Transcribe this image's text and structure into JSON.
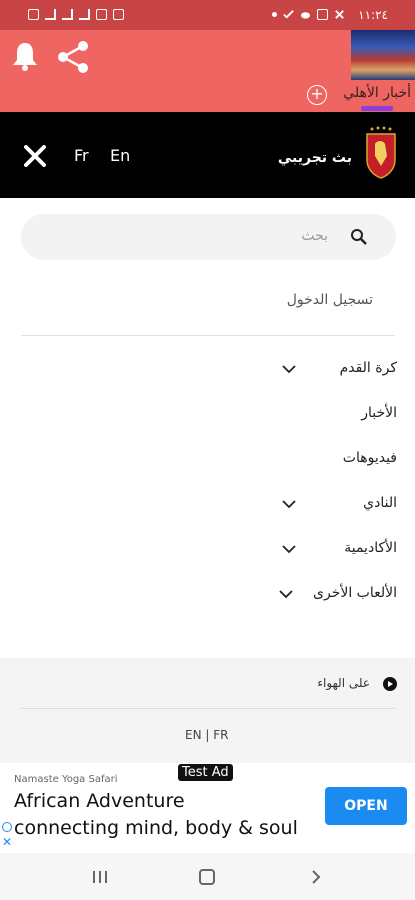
{
  "status_bar": {
    "time": "١١:٢٤",
    "left_icons": [
      "square-icon",
      "bars-icon",
      "bars-icon",
      "signal-icon",
      "mail-icon",
      "image-icon"
    ],
    "right_icons": [
      "dot-icon",
      "check-icon",
      "cloud-icon",
      "image-icon",
      "x-icon"
    ]
  },
  "app_bar": {
    "news_title": "أخبار الأهلي",
    "plus_label": "+",
    "accent_color": "#ee6562"
  },
  "drawer": {
    "lang_fr": "Fr",
    "lang_en": "En",
    "brand": "بث تجريبي"
  },
  "search": {
    "placeholder": "بحث"
  },
  "login_label": "تسجيل الدخول",
  "menu": {
    "items": [
      {
        "label": "كرة القدم",
        "expandable": true
      },
      {
        "label": "الأخبار",
        "expandable": false
      },
      {
        "label": "فيديوهات",
        "expandable": false
      },
      {
        "label": "النادي",
        "expandable": true
      },
      {
        "label": "الأكاديمية",
        "expandable": true
      },
      {
        "label": "الألعاب الأخرى",
        "expandable": true
      }
    ]
  },
  "footer": {
    "on_air": "على الهواء",
    "lang_switch": "EN | FR"
  },
  "ad": {
    "badge": "Test Ad",
    "advertiser": "Namaste Yoga Safari",
    "title": "African Adventure",
    "description": "connecting mind, body & soul",
    "cta": "OPEN",
    "close": "✕"
  }
}
